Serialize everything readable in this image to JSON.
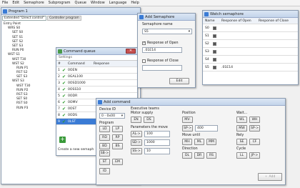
{
  "menu": [
    "File",
    "Edit",
    "Semaphore",
    "Subprogram",
    "Queue",
    "Window",
    "Language",
    "Help"
  ],
  "program": {
    "title": "Program 1",
    "tabs": [
      "Extended \"Direct control\"",
      "Controller program"
    ],
    "tree": [
      "Entry Point",
      "WRS S0",
      "SET S0",
      "SET S1",
      "SET S2",
      "SET S3",
      "RUN P0",
      "WST S1",
      "WST T30",
      "WST S2",
      "RUN P1",
      "RST S2",
      "SET S3",
      "WST S3",
      "WST T30",
      "RUN P2",
      "RST S3",
      "SET S0",
      "RST S0",
      "RUN P3"
    ]
  },
  "queue": {
    "title": "Command queue",
    "section": "Settings",
    "headers": [
      "#",
      "Command",
      "Response"
    ],
    "rows": [
      [
        "1",
        "0OEN"
      ],
      [
        "2",
        "0GAL100"
      ],
      [
        "3",
        "0OSD1000"
      ],
      [
        "4",
        "0OSS10"
      ],
      [
        "5",
        "0ODR"
      ],
      [
        "6",
        "0OMV"
      ],
      [
        "7",
        "0OST"
      ],
      [
        "8",
        "0ODS"
      ],
      [
        "9",
        "0LST"
      ]
    ],
    "footer": "Create a new semaph"
  },
  "addsem": {
    "title": "Add Semaphore",
    "name_label": "Semaphore name",
    "name_value": "S5",
    "open_label": "Response of Open",
    "open_value": ".01E14",
    "close_label": "Response of Close",
    "close_value": "",
    "edit": "Edit"
  },
  "watch": {
    "title": "Watch semaphore",
    "headers": [
      "Name",
      "",
      "Response of Open",
      "Response of Close"
    ],
    "rows": [
      [
        "S0",
        ""
      ],
      [
        "S1",
        ""
      ],
      [
        "S2",
        ""
      ],
      [
        "S3",
        ""
      ],
      [
        "S4",
        ""
      ],
      [
        "S5",
        ".01E14"
      ]
    ]
  },
  "addcmd": {
    "title": "Add command",
    "device_label": "Device ID",
    "device_value": "0 - 0x00",
    "exec_label": "Executive teams",
    "motor_label": "Motor supply",
    "motor_btns": [
      "EN",
      "DS"
    ],
    "program_label": "Program",
    "prog_btns": [
      "LD",
      "LP",
      "RD",
      "RP",
      "BD",
      "BS",
      "SB->"
    ],
    "params_label": "Parameters the move",
    "param_btns": [
      "AL->",
      "SD->",
      "SS->"
    ],
    "param_vals": [
      "100",
      "1000",
      "10"
    ],
    "st": "ST",
    "em": "EM",
    "id": "ID",
    "pos_label": "Position",
    "mv": "MV-",
    "sp": "SP->",
    "sp_val": "400",
    "move_label": "Move until",
    "mh": "MH",
    "ml": "ML",
    "mm": "MM",
    "dir_label": "Direction",
    "dl": "DL",
    "dr": "DR",
    "rs": "RS",
    "wait_label": "Wait...",
    "wl": "WL",
    "wh": "WH",
    "mw": "MW",
    "sp2": "SP->",
    "rely_label": "Rely",
    "se": "SE",
    "cf": "CF",
    "cycle_label": "Cycle",
    "ll": "LL",
    "jp": "JP->",
    "add": "Add"
  }
}
